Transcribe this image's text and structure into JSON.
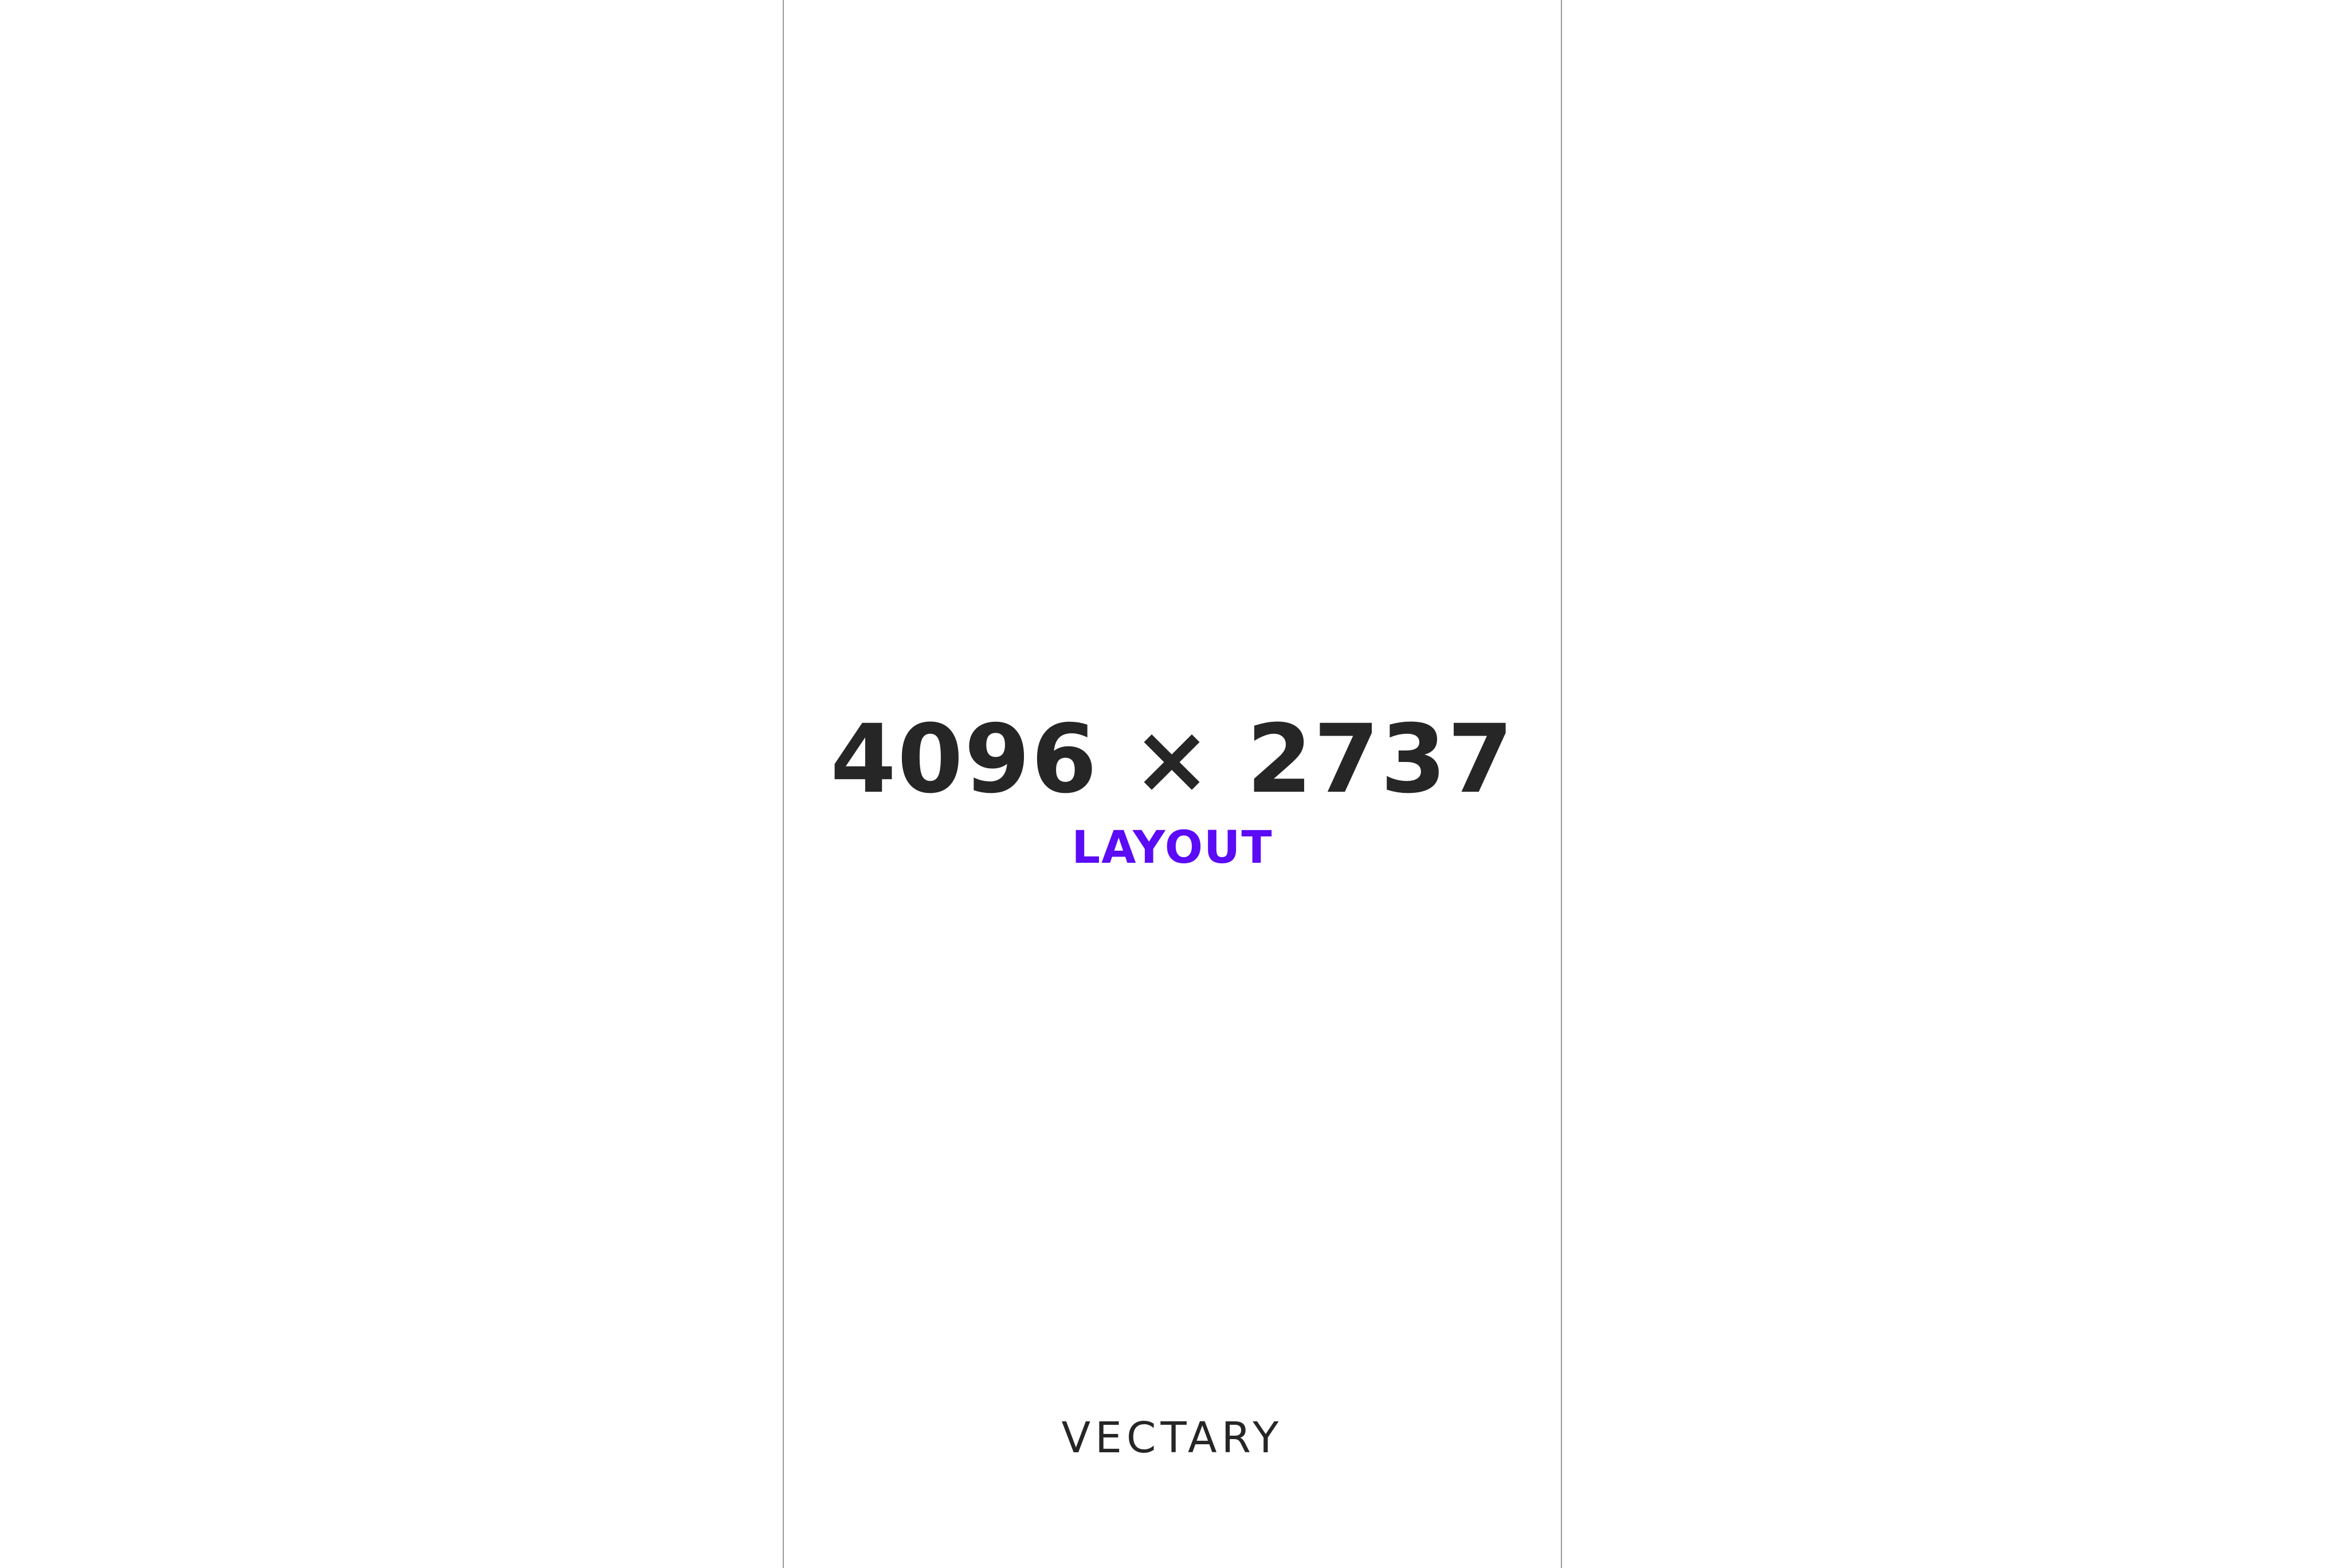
{
  "canvas": {
    "dimensions_text": "4096 × 2737",
    "label_text": "LAYOUT",
    "label_color": "#5b0bf5",
    "text_color": "#262626",
    "guide_color": "#9a9a9a"
  },
  "brand": {
    "logo_text": "VECTARY"
  }
}
